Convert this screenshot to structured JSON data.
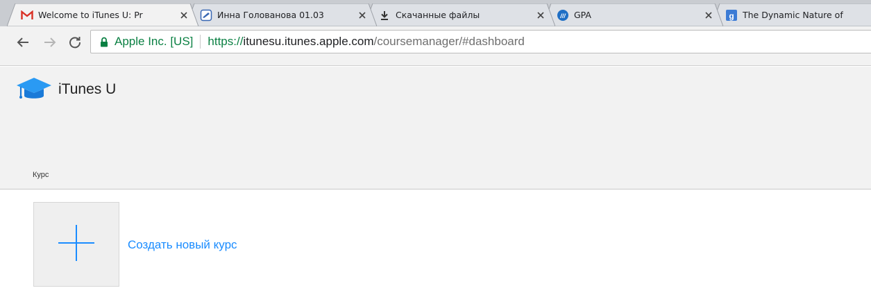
{
  "browser": {
    "tabs": [
      {
        "title": "Welcome to iTunes U: Pr",
        "favicon": "gmail-icon",
        "closable": true
      },
      {
        "title": "Инна Голованова 01.03",
        "favicon": "document-icon",
        "closable": true
      },
      {
        "title": "Скачанные файлы",
        "favicon": "download-icon",
        "closable": true
      },
      {
        "title": "GPA",
        "favicon": "gpa-site-icon",
        "closable": true
      },
      {
        "title": "The Dynamic Nature of",
        "favicon": "google-site-icon",
        "closable": false
      }
    ],
    "address_bar": {
      "org": "Apple Inc. [US]",
      "scheme": "https://",
      "host": "itunesu.itunes.apple.com",
      "path": "/coursemanager/#dashboard"
    }
  },
  "app": {
    "title": "iTunes U",
    "nav_label": "Курс"
  },
  "main": {
    "create_course_label": "Создать новый курс"
  },
  "colors": {
    "secure_green": "#0b8043",
    "link_blue": "#1a8cff",
    "logo_blue": "#2a9af3"
  }
}
